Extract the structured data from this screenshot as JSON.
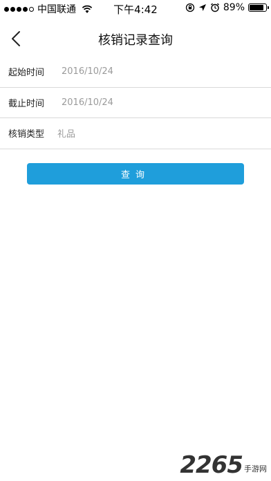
{
  "status_bar": {
    "carrier": "中国联通",
    "time": "下午4:42",
    "battery": "89%",
    "battery_level": 0.89
  },
  "nav": {
    "title": "核销记录查询"
  },
  "form": {
    "rows": [
      {
        "label": "起始时间",
        "value": "2016/10/24"
      },
      {
        "label": "截止时间",
        "value": "2016/10/24"
      },
      {
        "label": "核销类型",
        "value": "礼品"
      }
    ]
  },
  "actions": {
    "query_label": "查询"
  },
  "watermark": {
    "big": "2265",
    "small": "手游网"
  },
  "colors": {
    "primary": "#1f9edb",
    "divider": "#d9d9d9",
    "placeholder": "#9a9a9a"
  }
}
